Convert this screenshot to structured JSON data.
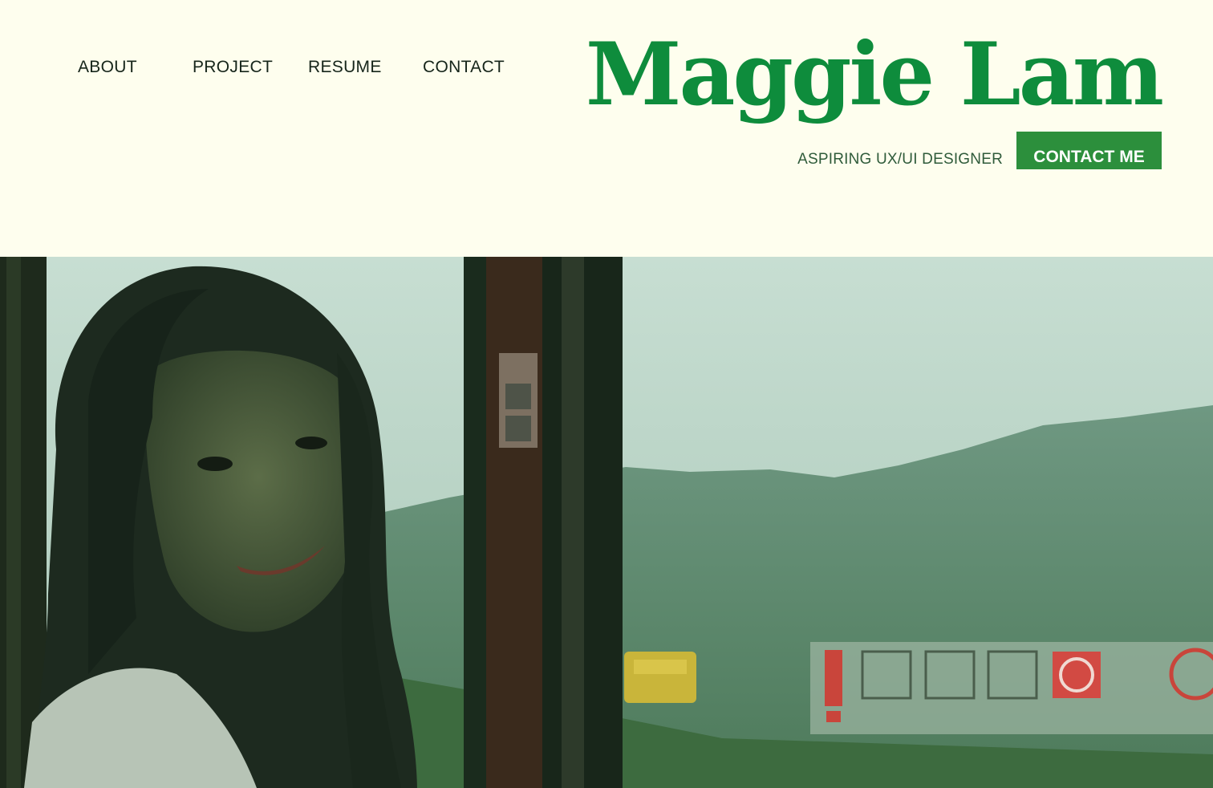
{
  "nav": {
    "items": [
      {
        "label": "ABOUT"
      },
      {
        "label": "PROJECT"
      },
      {
        "label": "RESUME"
      },
      {
        "label": "CONTACT"
      }
    ]
  },
  "brand": {
    "name": "Maggie Lam",
    "tagline": "ASPIRING UX/UI DESIGNER"
  },
  "cta": {
    "label": "CONTACT ME"
  },
  "hero": {
    "image_description": ""
  },
  "colors": {
    "page_background": "#fefeee",
    "brand_green": "#0e8c3c",
    "button_green": "#2c8f3c",
    "nav_text": "#16251a",
    "tagline_text": "#2f5b3a"
  }
}
